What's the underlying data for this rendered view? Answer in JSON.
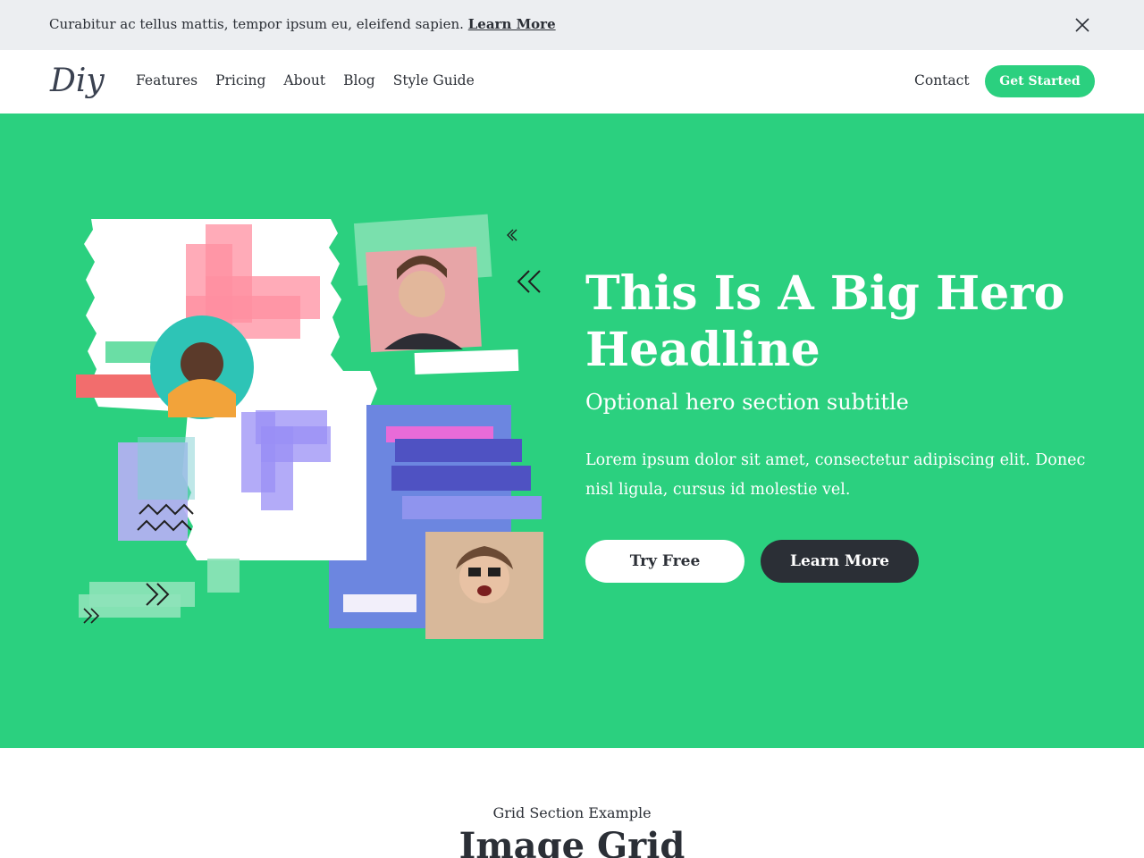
{
  "announcement": {
    "text": "Curabitur ac tellus mattis, tempor ipsum eu, eleifend sapien.",
    "link_label": "Learn More",
    "close_icon": "close-icon"
  },
  "header": {
    "logo_text": "Diy",
    "nav": [
      "Features",
      "Pricing",
      "About",
      "Blog",
      "Style Guide"
    ],
    "contact_label": "Contact",
    "cta_label": "Get Started"
  },
  "hero": {
    "title": "This Is A Big Hero Headline",
    "subtitle": "Optional hero section subtitle",
    "body": "Lorem ipsum dolor sit amet, consectetur adipiscing elit. Donec nisl ligula, cursus id molestie vel.",
    "primary_button": "Try Free",
    "secondary_button": "Learn More"
  },
  "grid_section": {
    "eyebrow": "Grid Section Example",
    "title": "Image Grid"
  },
  "colors": {
    "brand_green": "#2bd07f",
    "dark": "#2b2f36",
    "announcement_bg": "#eceef1"
  }
}
